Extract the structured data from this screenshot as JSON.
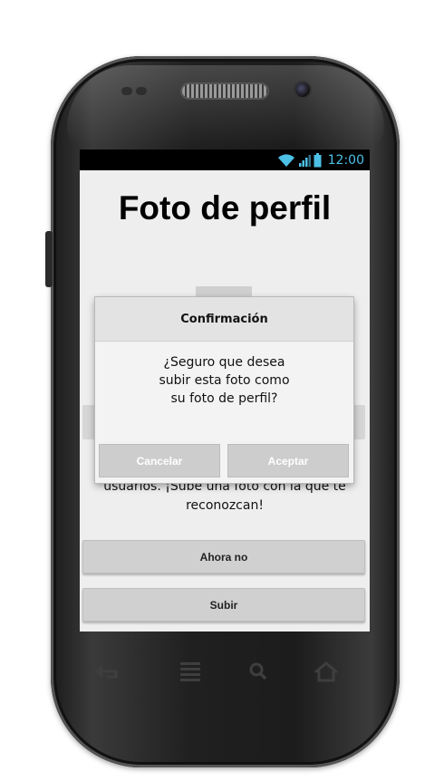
{
  "status_bar": {
    "time": "12:00",
    "icons": [
      "wifi-icon",
      "signal-icon",
      "battery-icon"
    ],
    "accent_color": "#4dc0e6"
  },
  "screen": {
    "title": "Foto de perfil",
    "description_lines": [
      "usuarios. ¡Sube una foto con la que te",
      "reconozcan!"
    ],
    "buttons": {
      "not_now": "Ahora no",
      "upload": "Subir"
    }
  },
  "dialog": {
    "title": "Confirmación",
    "message_lines": [
      "¿Seguro que desea",
      "subir esta foto como",
      "su foto de perfil?"
    ],
    "cancel_label": "Cancelar",
    "accept_label": "Aceptar"
  },
  "nav_bar": {
    "icons": [
      "back-icon",
      "menu-icon",
      "search-icon",
      "home-icon"
    ]
  }
}
